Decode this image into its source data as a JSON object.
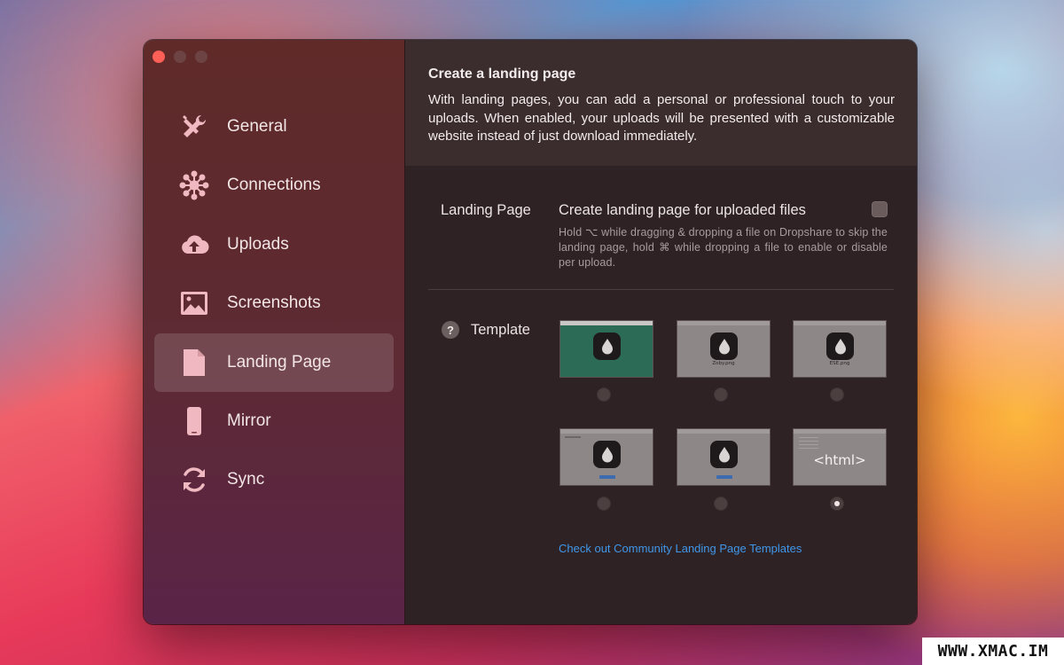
{
  "window": {
    "controls": [
      "close",
      "minimize",
      "maximize"
    ]
  },
  "sidebar": {
    "items": [
      {
        "label": "General",
        "icon": "tools-icon",
        "active": false
      },
      {
        "label": "Connections",
        "icon": "network-icon",
        "active": false
      },
      {
        "label": "Uploads",
        "icon": "cloud-upload-icon",
        "active": false
      },
      {
        "label": "Screenshots",
        "icon": "image-icon",
        "active": false
      },
      {
        "label": "Landing Page",
        "icon": "document-icon",
        "active": true
      },
      {
        "label": "Mirror",
        "icon": "phone-icon",
        "active": false
      },
      {
        "label": "Sync",
        "icon": "sync-icon",
        "active": false
      }
    ]
  },
  "header": {
    "title": "Create a landing page",
    "description": "With landing pages, you can add a personal or professional touch to your uploads. When enabled, your uploads will be presented with a customizable website instead of just download immediately."
  },
  "landing_page": {
    "label": "Landing Page",
    "option_label": "Create landing page for uploaded files",
    "checked": false,
    "help_text": "Hold ⌥ while dragging & dropping a file on Dropshare to skip the landing page, hold ⌘ while dropping a file to enable or disable per upload."
  },
  "template": {
    "help_symbol": "?",
    "label": "Template",
    "options": [
      {
        "name": "template-green",
        "caption": "",
        "selected": false
      },
      {
        "name": "template-gray-file",
        "caption": "Zoby.png",
        "selected": false
      },
      {
        "name": "template-gray-file-2",
        "caption": "ESE.png",
        "selected": false
      },
      {
        "name": "template-gray-button",
        "caption": "",
        "selected": false
      },
      {
        "name": "template-gray-button-2",
        "caption": "",
        "selected": false
      },
      {
        "name": "template-html",
        "caption": "<html>",
        "selected": true
      }
    ],
    "community_link": "Check out Community Landing Page Templates"
  },
  "colors": {
    "accent_link": "#3f97ea",
    "close_button": "#fe5f57",
    "sidebar_top": "#5f2a28",
    "content_bg": "#2e2224"
  },
  "watermark": "WWW.XMAC.IM"
}
